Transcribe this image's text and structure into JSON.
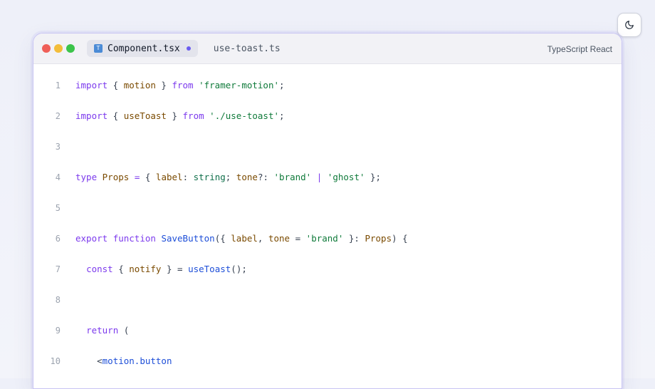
{
  "editor": {
    "tabs": [
      {
        "label": "Component.tsx",
        "icon": "typescript-file-icon",
        "modified": true,
        "active": true
      },
      {
        "label": "use-toast.ts",
        "active": false
      }
    ],
    "language": "TypeScript React",
    "traffic_lights": [
      "#ef5f58",
      "#f3bd3a",
      "#3cc44a"
    ],
    "colors": {
      "keyword": "#7c3aed",
      "identifier": "#7a4a00",
      "string": "#0f7a3a",
      "function": "#1d4ed8",
      "type": "#0f6f4a",
      "modified_dot": "#6a5cf0"
    },
    "lines": [
      {
        "n": "1",
        "tokens": [
          [
            "kw",
            "import"
          ],
          [
            "punc",
            " { "
          ],
          [
            "id",
            "motion"
          ],
          [
            "punc",
            " } "
          ],
          [
            "kw",
            "from"
          ],
          [
            "punc",
            " "
          ],
          [
            "str",
            "'framer-motion'"
          ],
          [
            "punc",
            ";"
          ]
        ]
      },
      {
        "n": "2",
        "tokens": [
          [
            "kw",
            "import"
          ],
          [
            "punc",
            " { "
          ],
          [
            "id",
            "useToast"
          ],
          [
            "punc",
            " } "
          ],
          [
            "kw",
            "from"
          ],
          [
            "punc",
            " "
          ],
          [
            "str",
            "'./use-toast'"
          ],
          [
            "punc",
            ";"
          ]
        ]
      },
      {
        "n": "3",
        "tokens": []
      },
      {
        "n": "4",
        "tokens": [
          [
            "kw",
            "type"
          ],
          [
            "punc",
            " "
          ],
          [
            "id",
            "Props"
          ],
          [
            "punc",
            " "
          ],
          [
            "kw",
            "="
          ],
          [
            "punc",
            " { "
          ],
          [
            "id",
            "label"
          ],
          [
            "punc",
            ": "
          ],
          [
            "ty",
            "string"
          ],
          [
            "punc",
            "; "
          ],
          [
            "id",
            "tone"
          ],
          [
            "punc",
            "?: "
          ],
          [
            "str",
            "'brand'"
          ],
          [
            "punc",
            " "
          ],
          [
            "kw",
            "|"
          ],
          [
            "punc",
            " "
          ],
          [
            "str",
            "'ghost'"
          ],
          [
            "punc",
            " };"
          ]
        ]
      },
      {
        "n": "5",
        "tokens": []
      },
      {
        "n": "6",
        "tokens": [
          [
            "kw",
            "export"
          ],
          [
            "punc",
            " "
          ],
          [
            "kw",
            "function"
          ],
          [
            "punc",
            " "
          ],
          [
            "fn",
            "SaveButton"
          ],
          [
            "punc",
            "({ "
          ],
          [
            "id",
            "label"
          ],
          [
            "punc",
            ", "
          ],
          [
            "id",
            "tone"
          ],
          [
            "punc",
            " = "
          ],
          [
            "str",
            "'brand'"
          ],
          [
            "punc",
            " }: "
          ],
          [
            "id",
            "Props"
          ],
          [
            "punc",
            ") {"
          ]
        ]
      },
      {
        "n": "7",
        "tokens": [
          [
            "punc",
            "  "
          ],
          [
            "kw",
            "const"
          ],
          [
            "punc",
            " { "
          ],
          [
            "id",
            "notify"
          ],
          [
            "punc",
            " } = "
          ],
          [
            "fn",
            "useToast"
          ],
          [
            "punc",
            "();"
          ]
        ]
      },
      {
        "n": "8",
        "tokens": []
      },
      {
        "n": "9",
        "tokens": [
          [
            "punc",
            "  "
          ],
          [
            "kw",
            "return"
          ],
          [
            "punc",
            " ("
          ]
        ]
      },
      {
        "n": "10",
        "tokens": [
          [
            "punc",
            "    <"
          ],
          [
            "fn",
            "motion.button"
          ]
        ]
      }
    ]
  }
}
